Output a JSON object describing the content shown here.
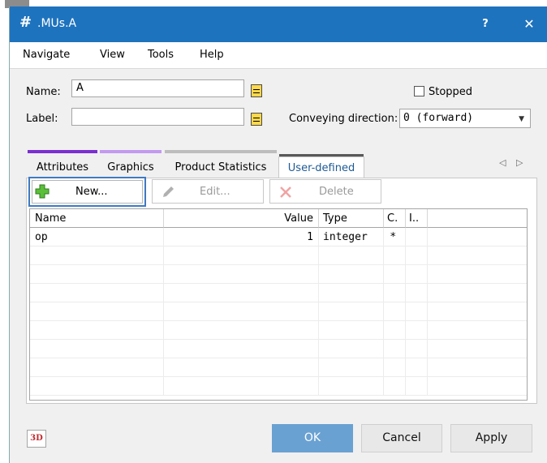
{
  "window": {
    "title": ".MUs.A",
    "help_label": "?",
    "close_label": "✕"
  },
  "menu": [
    "Navigate",
    "View",
    "Tools",
    "Help"
  ],
  "form": {
    "name_label": "Name:",
    "name_value": "A",
    "label_label": "Label:",
    "label_value": "",
    "stopped_label": "Stopped",
    "stopped_checked": false,
    "conveying_label": "Conveying direction:",
    "conveying_value": "0 (forward)"
  },
  "tabs": [
    {
      "label": "Attributes",
      "color": "#7b2fd1"
    },
    {
      "label": "Graphics",
      "color": "#c39af0"
    },
    {
      "label": "Product Statistics",
      "color": "#bdbdbd"
    },
    {
      "label": "User-defined",
      "color": "#595959",
      "active": true
    }
  ],
  "tab_nav": {
    "prev": "◁",
    "next": "▷"
  },
  "toolbar": {
    "new_label": "New...",
    "edit_label": "Edit...",
    "delete_label": "Delete"
  },
  "table": {
    "columns": [
      "Name",
      "Value",
      "Type",
      "C.",
      "I.."
    ],
    "rows": [
      {
        "name": "op",
        "value": "1",
        "type": "integer",
        "c": "*",
        "i": ""
      }
    ]
  },
  "footer": {
    "btn_3d": "3D",
    "ok_label": "OK",
    "cancel_label": "Cancel",
    "apply_label": "Apply"
  },
  "colors": {
    "titlebar": "#1e73be",
    "ok_button": "#6aa1d3",
    "focus_border": "#3f7ac2"
  }
}
